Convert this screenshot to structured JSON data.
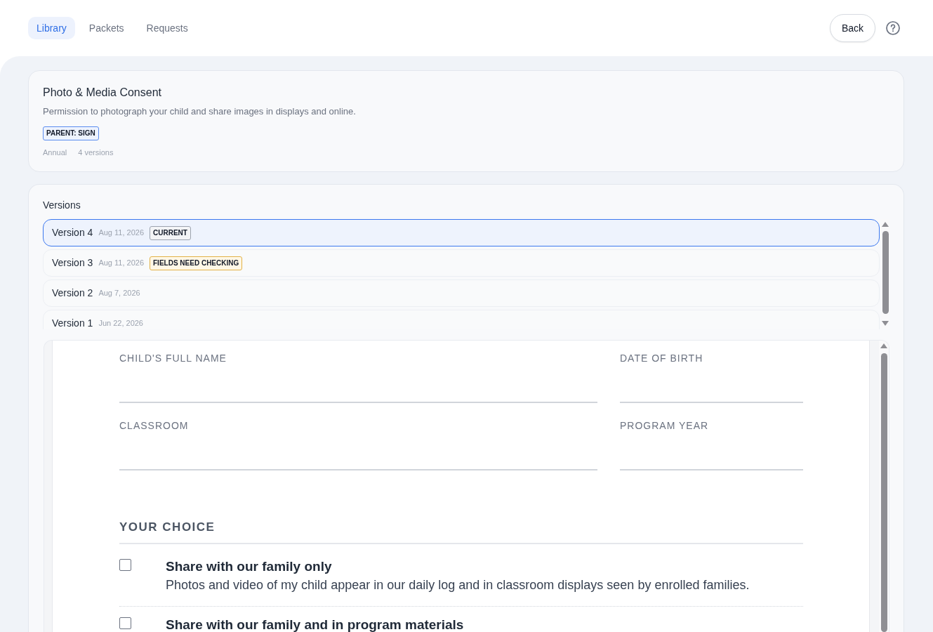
{
  "nav": {
    "tabs": [
      {
        "label": "Library",
        "selected": true
      },
      {
        "label": "Packets",
        "selected": false
      },
      {
        "label": "Requests",
        "selected": false
      }
    ],
    "back_button": "Back"
  },
  "form_card": {
    "title": "Photo & Media Consent",
    "description": "Permission to photograph your child and share images in displays and online.",
    "badge": {
      "text": "PARENT: SIGN",
      "kind": "role"
    },
    "meta": [
      "Annual",
      "4 versions"
    ]
  },
  "versions": {
    "heading": "Versions",
    "items": [
      {
        "label": "Version 4",
        "date": "Aug 11, 2026",
        "badge": {
          "text": "CURRENT",
          "kind": "current"
        },
        "selected": true
      },
      {
        "label": "Version 3",
        "date": "Aug 11, 2026",
        "badge": {
          "text": "FIELDS NEED CHECKING",
          "kind": "warning"
        },
        "selected": false
      },
      {
        "label": "Version 2",
        "date": "Aug 7, 2026",
        "selected": false
      },
      {
        "label": "Version 1",
        "date": "Jun 22, 2026",
        "selected": false
      }
    ]
  },
  "document": {
    "fields": [
      {
        "label": "CHILD'S FULL NAME"
      },
      {
        "label": "DATE OF BIRTH"
      },
      {
        "label": "CLASSROOM"
      },
      {
        "label": "PROGRAM YEAR"
      }
    ],
    "section_heading": "YOUR CHOICE",
    "choices": [
      {
        "title": "Share with our family only",
        "description": "Photos and video of my child appear in our daily log and in classroom displays seen by enrolled families.",
        "checked": false
      },
      {
        "title": "Share with our family and in program materials",
        "checked": false
      }
    ]
  }
}
